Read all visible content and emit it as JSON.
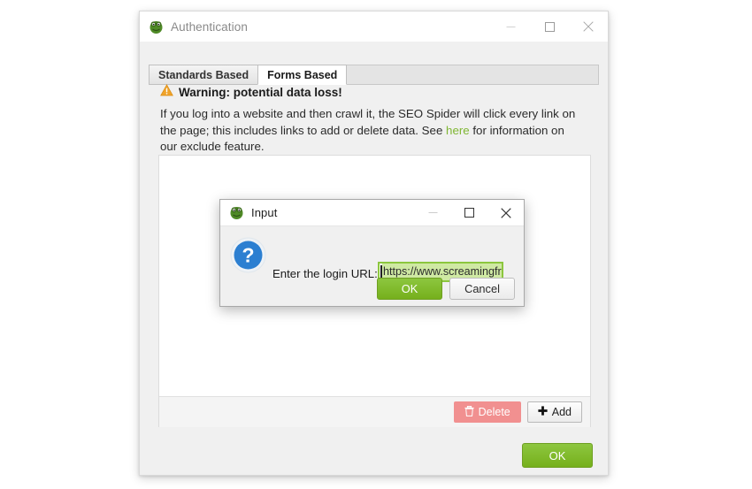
{
  "main_window": {
    "title": "Authentication",
    "icon": "screaming-frog-icon",
    "controls": {
      "minimize": "minimize-icon",
      "maximize": "maximize-icon",
      "close": "close-icon"
    },
    "tabs": [
      {
        "label": "Standards Based",
        "active": false
      },
      {
        "label": "Forms Based",
        "active": true
      }
    ],
    "warning": {
      "icon": "warning-triangle-icon",
      "heading": "Warning: potential data loss!",
      "body_before_link": "If you log into a website and then crawl it, the SEO Spider will click every link on the page; this includes links to add or delete data. See ",
      "link_text": "here",
      "body_after_link": " for information on our exclude feature."
    },
    "panel": {
      "delete_button": {
        "label": "Delete",
        "icon": "trash-icon",
        "enabled": false
      },
      "add_button": {
        "label": "Add",
        "icon": "plus-icon",
        "enabled": true
      }
    },
    "ok_button": "OK"
  },
  "input_dialog": {
    "title": "Input",
    "icon": "screaming-frog-icon",
    "controls": {
      "minimize": "minimize-icon",
      "maximize": "maximize-icon",
      "close": "close-icon"
    },
    "question_icon": "question-mark-icon",
    "label": "Enter the login URL:",
    "input_value": "https://www.screamingfro",
    "input_full_value": "https://www.screamingfrog.co.uk",
    "ok_button": "OK",
    "cancel_button": "Cancel"
  },
  "colors": {
    "accent_green": "#7fb632",
    "button_green": "#8dc63f",
    "warning_orange": "#f0a32a",
    "delete_red": "#f19090",
    "question_blue": "#2c7fd1",
    "selection_green": "#cfe9a3"
  }
}
